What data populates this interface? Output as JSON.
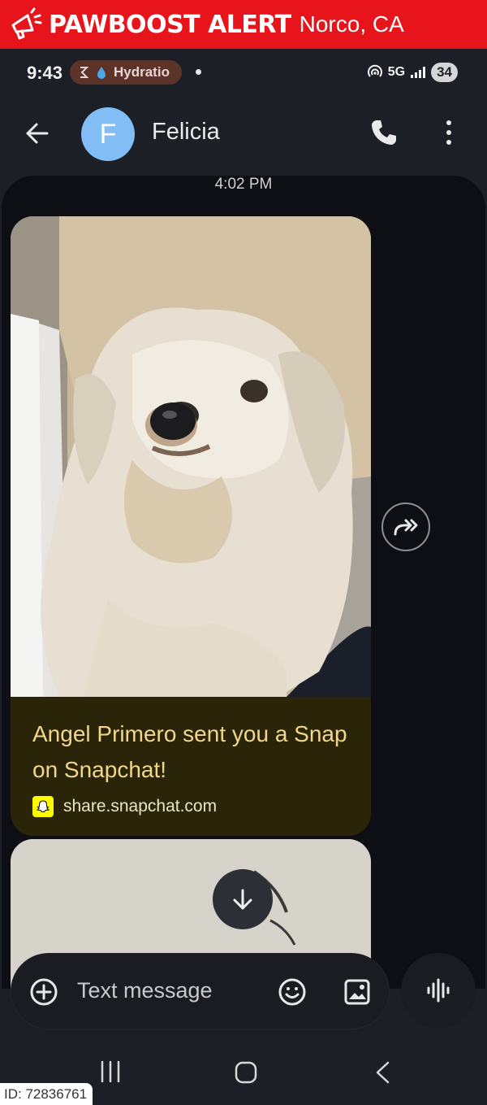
{
  "banner": {
    "icon": "megaphone-icon",
    "brand": "PAWBOOST ALERT",
    "location": "Norco, CA",
    "color": "#e8141b"
  },
  "status_bar": {
    "time": "9:43",
    "pill_label": "Hydratio",
    "network": "5G",
    "battery": "34"
  },
  "app_bar": {
    "avatar_letter": "F",
    "contact_name": "Felicia"
  },
  "thread": {
    "timestamp": "4:02 PM",
    "message": {
      "card_title": "Angel Primero sent you a Snap on Snapchat!",
      "card_link": "share.snapchat.com",
      "image_subject": "long-haired white small dog"
    }
  },
  "composer": {
    "placeholder": "Text message"
  },
  "footer": {
    "id_label": "ID: 72836761"
  }
}
